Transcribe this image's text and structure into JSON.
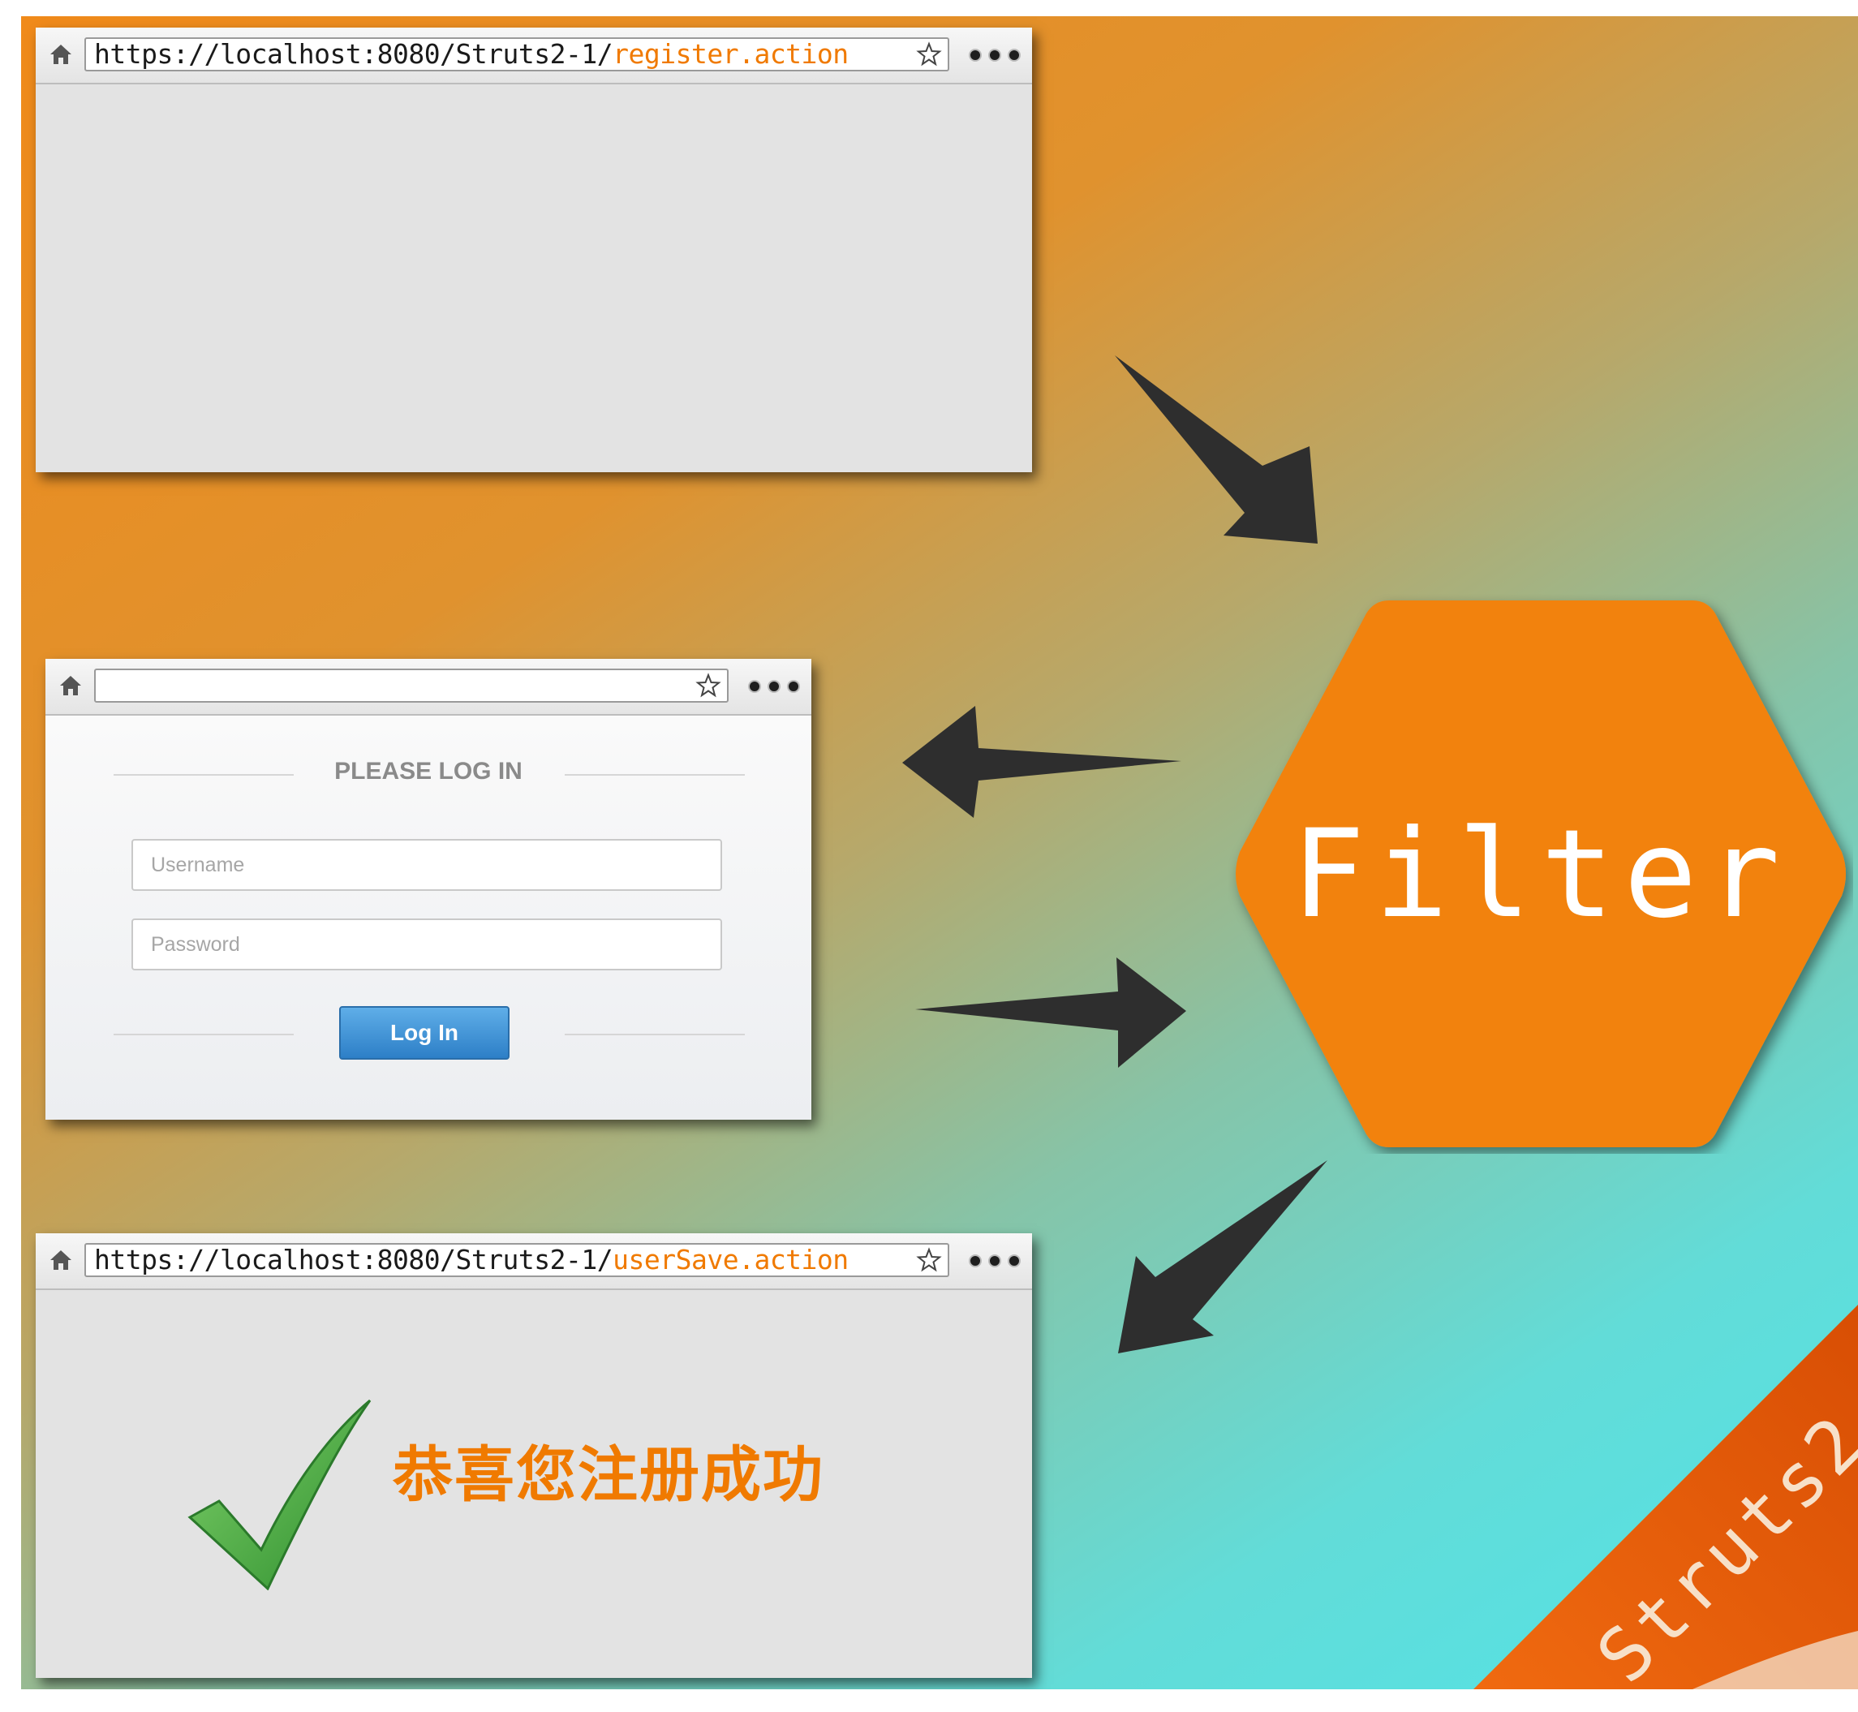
{
  "browser_top": {
    "url_base": "https://localhost:8080/Struts2-1/",
    "url_action": "register.action"
  },
  "browser_middle": {
    "url_base": "",
    "url_action": "",
    "title": "PLEASE LOG IN",
    "username_placeholder": "Username",
    "password_placeholder": "Password",
    "login_button": "Log In"
  },
  "browser_bottom": {
    "url_base": "https://localhost:8080/Struts2-1/",
    "url_action": "userSave.action",
    "message": "恭喜您注册成功"
  },
  "filter": {
    "label": "Filter",
    "color": "#f28210"
  },
  "ribbon": {
    "label": "Struts2",
    "color": "#e85a08"
  },
  "colors": {
    "accent_orange": "#f07a00",
    "arrow": "#2e2e2e",
    "check_green": "#3fa23a",
    "button_blue": "#3a8fd6"
  },
  "icons": [
    "home-icon",
    "star-icon",
    "menu-dots-icon",
    "checkmark-icon",
    "arrow-icon"
  ]
}
